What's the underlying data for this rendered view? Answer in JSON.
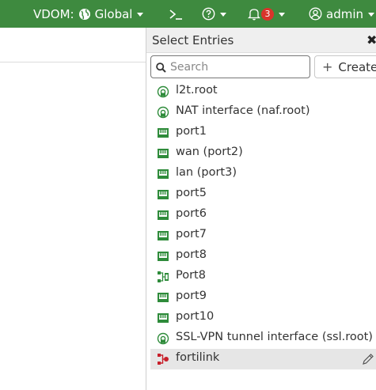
{
  "topbar": {
    "vdom_label": "VDOM:",
    "vdom_value": "Global",
    "notification_count": "3",
    "user": "admin",
    "bar_color": "#3e8a3f"
  },
  "panel": {
    "title": "Select Entries",
    "search_placeholder": "Search",
    "create_label": "Create",
    "entries": [
      {
        "label": "l2t.root",
        "icon": "tunnel-interface-icon"
      },
      {
        "label": "NAT interface (naf.root)",
        "icon": "tunnel-interface-icon"
      },
      {
        "label": "port1",
        "icon": "physical-port-icon"
      },
      {
        "label": "wan (port2)",
        "icon": "physical-port-icon"
      },
      {
        "label": "lan (port3)",
        "icon": "physical-port-icon"
      },
      {
        "label": "port5",
        "icon": "physical-port-icon"
      },
      {
        "label": "port6",
        "icon": "physical-port-icon"
      },
      {
        "label": "port7",
        "icon": "physical-port-icon"
      },
      {
        "label": "port8",
        "icon": "physical-port-icon"
      },
      {
        "label": "Port8",
        "icon": "switch-interface-icon"
      },
      {
        "label": "port9",
        "icon": "physical-port-icon"
      },
      {
        "label": "port10",
        "icon": "physical-port-icon"
      },
      {
        "label": "SSL-VPN tunnel interface (ssl.root)",
        "icon": "tunnel-interface-icon"
      },
      {
        "label": "fortilink",
        "icon": "fortilink-icon",
        "selected": true
      }
    ]
  }
}
